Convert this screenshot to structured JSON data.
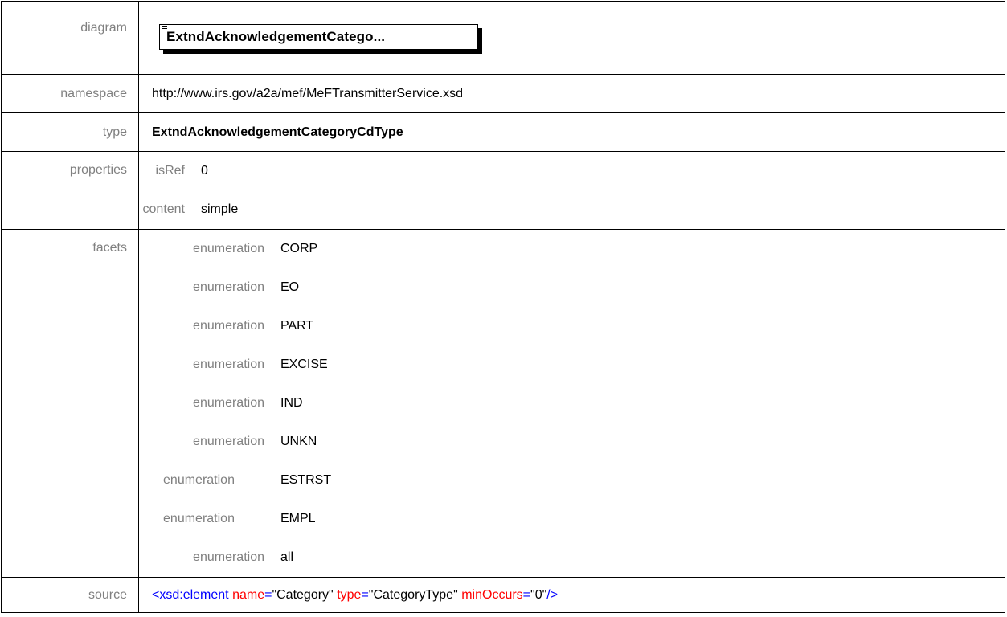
{
  "rows": {
    "diagram": {
      "label": "diagram",
      "box_title": "ExtndAcknowledgementCatego..."
    },
    "namespace": {
      "label": "namespace",
      "value": "http://www.irs.gov/a2a/mef/MeFTransmitterService.xsd"
    },
    "type": {
      "label": "type",
      "value": "ExtndAcknowledgementCategoryCdType"
    },
    "properties": {
      "label": "properties",
      "items": [
        {
          "key": "isRef",
          "value": "0"
        },
        {
          "key": "content",
          "value": "simple"
        }
      ]
    },
    "facets": {
      "label": "facets",
      "items": [
        {
          "key": "enumeration",
          "value": "CORP"
        },
        {
          "key": "enumeration",
          "value": "EO"
        },
        {
          "key": "enumeration",
          "value": "PART"
        },
        {
          "key": "enumeration",
          "value": "EXCISE"
        },
        {
          "key": "enumeration",
          "value": "IND"
        },
        {
          "key": "enumeration",
          "value": "UNKN"
        },
        {
          "key": "enumeration",
          "value": "ESTRST"
        },
        {
          "key": "enumeration",
          "value": "EMPL"
        },
        {
          "key": "enumeration",
          "value": "all"
        }
      ]
    },
    "source": {
      "label": "source",
      "open": "<xsd:element",
      "attr1": "name",
      "val1": "Category",
      "attr2": "type",
      "val2": "CategoryType",
      "attr3": "minOccurs",
      "val3": "0",
      "close": "/>",
      "eq": "=",
      "quote": "\""
    }
  }
}
